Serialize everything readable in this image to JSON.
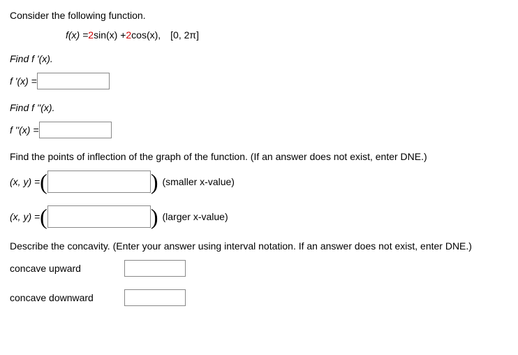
{
  "intro": "Consider the following function.",
  "fn": {
    "prefix": "f",
    "args": "(x) = ",
    "coef1": "2",
    "mid1": " sin(x) + ",
    "coef2": "2",
    "mid2": " cos(x), [0, 2π]"
  },
  "q1": {
    "prompt": "Find f '(x).",
    "label_pre": "f '(x) = "
  },
  "q2": {
    "prompt": "Find f ''(x).",
    "label_pre": "f ''(x) = "
  },
  "q3": {
    "prompt": "Find the points of inflection of the graph of the function. (If an answer does not exist, enter DNE.)",
    "xy": "(x, y)  =  ",
    "note_small": "(smaller x-value)",
    "note_large": "(larger x-value)"
  },
  "q4": {
    "prompt": "Describe the concavity. (Enter your answer using interval notation. If an answer does not exist, enter DNE.)",
    "up": "concave upward",
    "down": "concave downward"
  }
}
